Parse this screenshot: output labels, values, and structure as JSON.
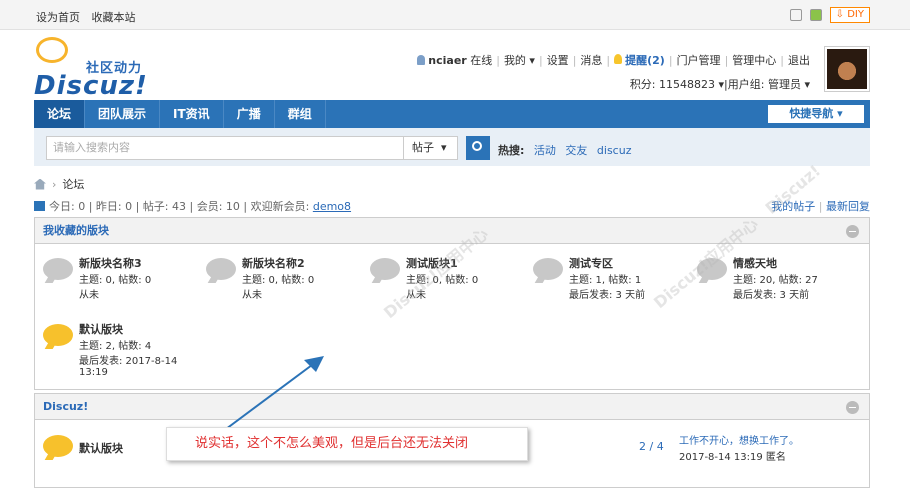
{
  "topbar": {
    "set_home": "设为首页",
    "bookmark": "收藏本站",
    "diy": "DIY"
  },
  "logo": {
    "slogan": "社区动力",
    "word": "Discuz!"
  },
  "user": {
    "name": "nciaer",
    "online": "在线",
    "my": "我的",
    "settings": "设置",
    "messages": "消息",
    "remind": "提醒(2)",
    "portal_admin": "门户管理",
    "admin_center": "管理中心",
    "logout": "退出",
    "credits": "积分: 11548823",
    "group": "用户组: 管理员"
  },
  "nav": {
    "items": [
      "论坛",
      "团队展示",
      "IT资讯",
      "广播",
      "群组"
    ],
    "quick": "快捷导航"
  },
  "search": {
    "placeholder": "请输入搜索内容",
    "type": "帖子",
    "hot_label": "热搜:",
    "hot": [
      "活动",
      "交友",
      "discuz"
    ]
  },
  "breadcrumb": {
    "current": "论坛"
  },
  "stats": {
    "today": "今日: 0",
    "yesterday": "昨日: 0",
    "posts": "帖子: 43",
    "members": "会员: 10",
    "welcome": "欢迎新会员:",
    "newest": "demo8",
    "my_posts": "我的帖子",
    "latest_reply": "最新回复"
  },
  "fav": {
    "title": "我收藏的版块",
    "forums": [
      {
        "name": "新版块名称3",
        "stat": "主题: 0, 帖数: 0",
        "last": "从未"
      },
      {
        "name": "新版块名称2",
        "stat": "主题: 0, 帖数: 0",
        "last": "从未"
      },
      {
        "name": "测试版块1",
        "stat": "主题: 0, 帖数: 0",
        "last": "从未"
      },
      {
        "name": "测试专区",
        "stat": "主题: 1, 帖数: 1",
        "last": "最后发表: 3 天前"
      },
      {
        "name": "情感天地",
        "stat": "主题: 20, 帖数: 27",
        "last": "最后发表: 3 天前"
      },
      {
        "name": "默认版块",
        "stat": "主题: 2, 帖数: 4",
        "last": "最后发表: 2017-8-14",
        "last2": "13:19"
      }
    ]
  },
  "cat": {
    "title": "Discuz!",
    "forum": {
      "name": "默认版块",
      "pages": "2 / 4",
      "last_title": "工作不开心，想换工作了。",
      "last_meta": "2017-8-14 13:19 匿名"
    }
  },
  "annotation": "说实话，这个不怎么美观，但是后台还无法关闭"
}
